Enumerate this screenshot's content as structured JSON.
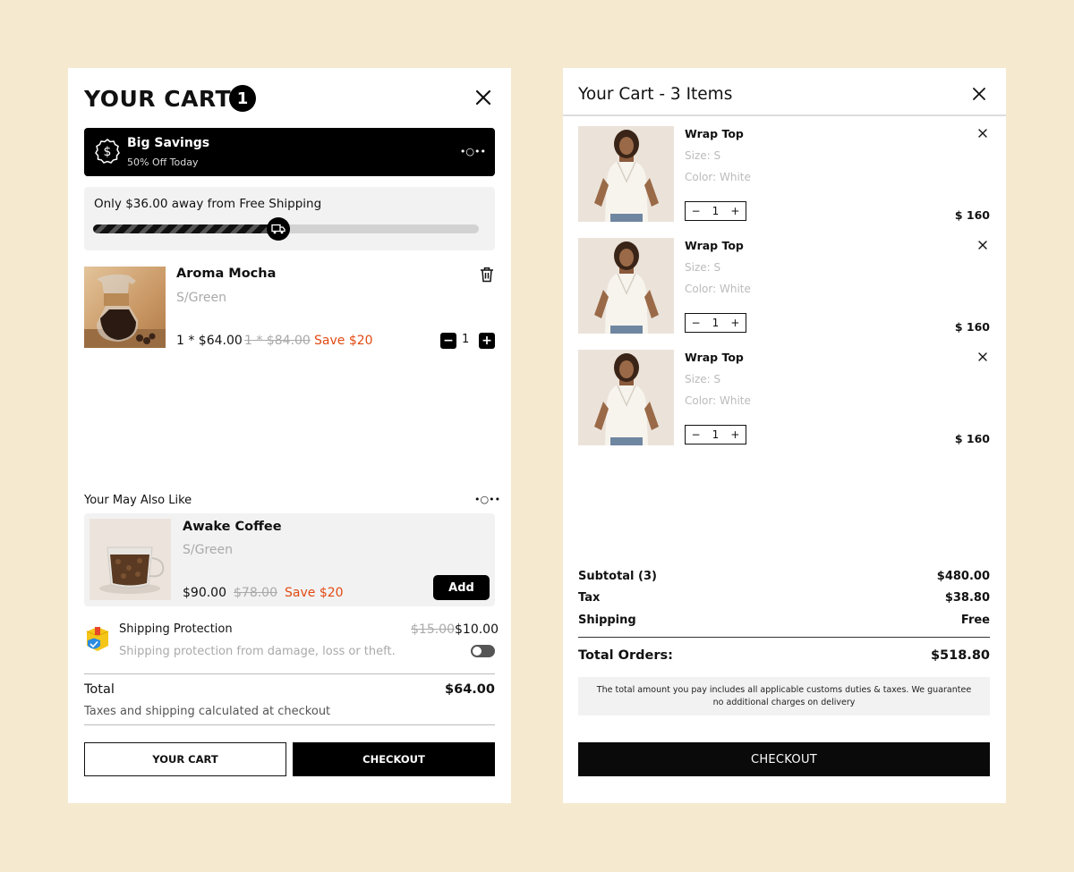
{
  "left_cart": {
    "title": "YOUR CART",
    "count_badge": "1",
    "promo": {
      "title": "Big Savings",
      "subtitle": "50% Off Today",
      "dots": "•○••"
    },
    "shipping_progress": {
      "text": "Only $36.00 away from Free Shipping",
      "progress": 0.48
    },
    "item": {
      "name": "Aroma Mocha",
      "variant": "S/Green",
      "price": "1 * $64.00",
      "old_price": "1 * $84.00",
      "save": "Save $20",
      "qty_minus": "−",
      "quantity": "1",
      "qty_plus": "+"
    },
    "also_like": {
      "title": "Your May Also Like",
      "dots": "•○••",
      "product": {
        "name": "Awake Coffee",
        "variant": "S/Green",
        "price": "$90.00",
        "old_price": "$78.00",
        "save": "Save $20",
        "add_label": "Add"
      }
    },
    "shipping_protection": {
      "title": "Shipping Protection",
      "description": "Shipping protection from damage, loss or theft.",
      "old_price": "$15.00",
      "price": "$10.00",
      "enabled": false
    },
    "total": {
      "label": "Total",
      "value": "$64.00",
      "note": "Taxes and shipping calculated at checkout"
    },
    "buttons": {
      "cart": "YOUR CART",
      "checkout": "CHECKOUT"
    }
  },
  "right_cart": {
    "title": "Your Cart - 3 Items",
    "items": [
      {
        "name": "Wrap Top",
        "size": "Size: S",
        "color": "Color: White",
        "quantity": "1",
        "price": "$ 160"
      },
      {
        "name": "Wrap Top",
        "size": "Size: S",
        "color": "Color: White",
        "quantity": "1",
        "price": "$ 160"
      },
      {
        "name": "Wrap Top",
        "size": "Size: S",
        "color": "Color: White",
        "quantity": "1",
        "price": "$ 160"
      }
    ],
    "stepper": {
      "minus": "−",
      "plus": "+"
    },
    "summary": {
      "subtotal_label": "Subtotal (3)",
      "subtotal_value": "$480.00",
      "tax_label": "Tax",
      "tax_value": "$38.80",
      "shipping_label": "Shipping",
      "shipping_value": "Free",
      "total_label": "Total Orders:",
      "total_value": "$518.80"
    },
    "note": "The total amount you pay includes all applicable customs duties & taxes. We guarantee no additional charges on delivery",
    "checkout_label": "CHECKOUT"
  },
  "colors": {
    "background": "#f5e9cf",
    "accent_save": "#e24a12",
    "dark": "#000000"
  }
}
